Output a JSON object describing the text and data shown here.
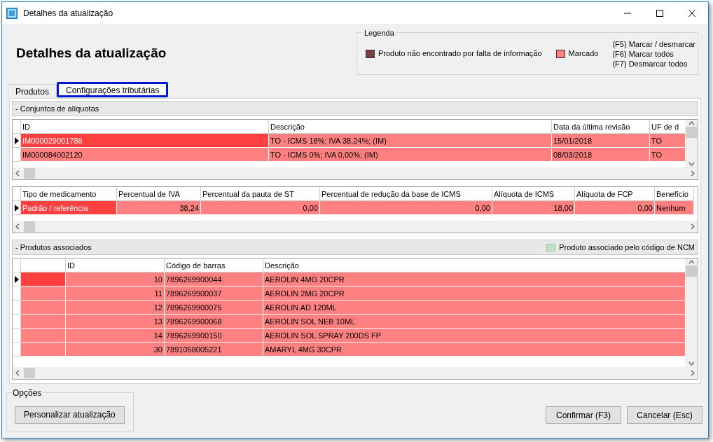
{
  "window": {
    "title": "Detalhes da atualização"
  },
  "heading": "Detalhes da atualização",
  "legend": {
    "title": "Legenda",
    "items": [
      {
        "label": "Produto não encontrado por falta de informação",
        "color": "#7b3f3f"
      },
      {
        "label": "Marcado",
        "color": "#ff8080"
      }
    ],
    "shortcuts": [
      "(F5) Marcar / desmarcar",
      "(F6) Marcar todos",
      "(F7) Desmarcar todos"
    ]
  },
  "tabs": [
    {
      "label": "Produtos",
      "selected": false
    },
    {
      "label": "Configurações tributárias",
      "selected": true
    }
  ],
  "aliquot_sets": {
    "title": "- Conjuntos de alíquotas",
    "columns": [
      {
        "label": "ID",
        "kind": "text"
      },
      {
        "label": "Descrição",
        "kind": "text"
      },
      {
        "label": "Data da última revisão",
        "kind": "text"
      },
      {
        "label": "UF de d",
        "kind": "text"
      }
    ],
    "rows": [
      {
        "selected": true,
        "cells": [
          "IM000029001786",
          "TO -  ICMS 18%; IVA 38,24%; (IM)",
          "15/01/2018",
          "TO"
        ]
      },
      {
        "selected": false,
        "cells": [
          "IM000084002120",
          "TO -  ICMS 0%; IVA 0,00%; (IM)",
          "08/03/2018",
          "TO"
        ]
      }
    ]
  },
  "medication": {
    "columns": [
      {
        "label": "Tipo de medicamento",
        "kind": "text"
      },
      {
        "label": "Percentual de IVA",
        "kind": "number"
      },
      {
        "label": "Percentual da pauta de ST",
        "kind": "number"
      },
      {
        "label": "Percentual de redução da base de ICMS",
        "kind": "number"
      },
      {
        "label": "Alíquota de ICMS",
        "kind": "number"
      },
      {
        "label": "Alíquota de FCP",
        "kind": "number"
      },
      {
        "label": "Benefício",
        "kind": "text"
      }
    ],
    "rows": [
      {
        "selected": true,
        "cells": [
          "Padrão / referência",
          "38,24",
          "0,00",
          "0,00",
          "18,00",
          "0,00",
          "Nenhum"
        ]
      }
    ]
  },
  "associated": {
    "title": "- Produtos associados",
    "legend": {
      "label": "Produto associado pelo código de NCM",
      "color": "#c4e0c4"
    },
    "columns": [
      {
        "label": "ID",
        "kind": "number"
      },
      {
        "label": "Código de barras",
        "kind": "text"
      },
      {
        "label": "Descrição",
        "kind": "text"
      }
    ],
    "rows": [
      {
        "selected": true,
        "cells": [
          "10",
          "7896269900044",
          "AEROLIN 4MG 20CPR"
        ]
      },
      {
        "selected": false,
        "cells": [
          "11",
          "7896269900037",
          "AEROLIN 2MG 20CPR"
        ]
      },
      {
        "selected": false,
        "cells": [
          "12",
          "7896269900075",
          "AEROLIN AD 120ML"
        ]
      },
      {
        "selected": false,
        "cells": [
          "13",
          "7896269900068",
          "AEROLIN SOL NEB 10ML"
        ]
      },
      {
        "selected": false,
        "cells": [
          "14",
          "7896269900150",
          "AEROLIN SOL SPRAY 200DS FP"
        ]
      },
      {
        "selected": false,
        "cells": [
          "30",
          "7891058005221",
          "AMARYL 4MG 30CPR"
        ]
      }
    ]
  },
  "options": {
    "title": "Opções",
    "button": "Personalizar atualização"
  },
  "buttons": [
    "Confirmar (F3)",
    "Cancelar (Esc)"
  ]
}
